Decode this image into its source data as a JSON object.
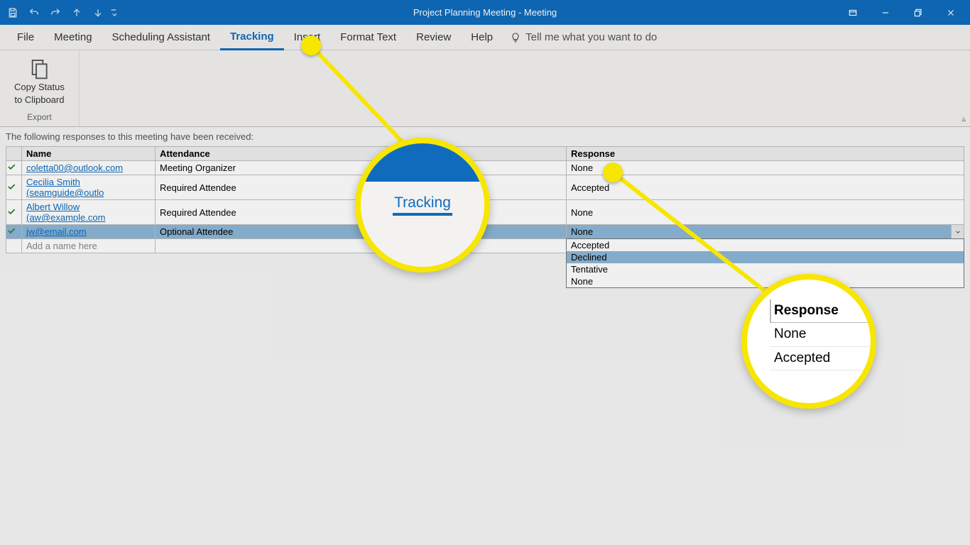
{
  "titlebar": {
    "title": "Project Planning Meeting  -  Meeting"
  },
  "ribbon_tabs": [
    "File",
    "Meeting",
    "Scheduling Assistant",
    "Tracking",
    "Insert",
    "Format Text",
    "Review",
    "Help"
  ],
  "active_tab_index": 3,
  "tell_me_placeholder": "Tell me what you want to do",
  "ribbon": {
    "copy_status_label_line1": "Copy Status",
    "copy_status_label_line2": "to Clipboard",
    "group_name": "Export"
  },
  "intro_text": "The following responses to this meeting have been received:",
  "table_headers": {
    "name": "Name",
    "attendance": "Attendance",
    "response": "Response"
  },
  "rows": [
    {
      "name": "coletta00@outlook.com",
      "attendance": "Meeting Organizer",
      "response": "None",
      "check": true,
      "link": true
    },
    {
      "name": "Cecilia Smith (seamguide@outlo",
      "attendance": "Required Attendee",
      "response": "Accepted",
      "check": true,
      "link": true
    },
    {
      "name": "Albert Willow (aw@example.com",
      "attendance": "Required Attendee",
      "response": "None",
      "check": true,
      "link": true
    },
    {
      "name": "jw@email.com",
      "attendance": "Optional Attendee",
      "response": "None",
      "check": true,
      "link": true,
      "selected": true,
      "dropdown_open": true
    }
  ],
  "add_row_placeholder": "Add a name here",
  "dropdown_options": [
    "Accepted",
    "Declined",
    "Tentative",
    "None"
  ],
  "dropdown_hover_index": 1,
  "zoom1_label": "Tracking",
  "zoom2": {
    "header": "Response",
    "r1": "None",
    "r2": "Accepted"
  }
}
